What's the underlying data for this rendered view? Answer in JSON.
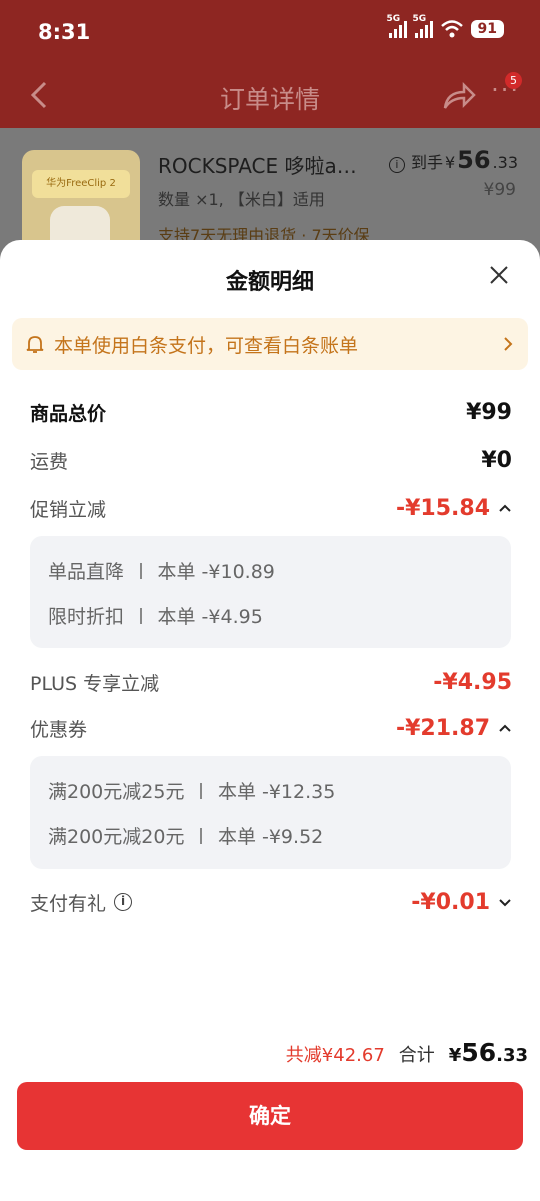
{
  "status": {
    "time": "8:31",
    "net1": "5G",
    "net2": "5G",
    "battery": "91"
  },
  "nav": {
    "title": "订单详情",
    "badge": "5",
    "more": "···"
  },
  "product": {
    "title": "ROCKSPACE 哆啦a…",
    "image_banner": "华为FreeClip 2",
    "spec": "数量 ×1, 【米白】适用",
    "service": "支持7天无理由退货 · 7天价保",
    "price_prefix": "到手",
    "price_currency": "¥",
    "price_int": "56",
    "price_dec": ".33",
    "original_price": "¥99"
  },
  "sheet": {
    "title": "金额明细",
    "notice": "本单使用白条支付，可查看白条账单",
    "rows": {
      "goods_total": {
        "label": "商品总价",
        "value": "¥99"
      },
      "shipping": {
        "label": "运费",
        "value": "¥0"
      },
      "promo": {
        "label": "促销立减",
        "value": "-¥15.84"
      },
      "plus": {
        "label": "PLUS 专享立减",
        "value": "-¥4.95"
      },
      "coupon": {
        "label": "优惠券",
        "value": "-¥21.87"
      },
      "pay_gift": {
        "label": "支付有礼",
        "value": "-¥0.01"
      }
    },
    "promo_details": [
      {
        "name": "单品直降",
        "amount": "本单 -¥10.89"
      },
      {
        "name": "限时折扣",
        "amount": "本单 -¥4.95"
      }
    ],
    "coupon_details": [
      {
        "name": "满200元减25元",
        "amount": "本单 -¥12.35"
      },
      {
        "name": "满200元减20元",
        "amount": "本单 -¥9.52"
      }
    ],
    "summary": {
      "saved": "共减¥42.67",
      "total_label": "合计",
      "total_currency": "¥",
      "total_int": "56",
      "total_dec": ".33"
    },
    "confirm_label": "确定"
  },
  "colors": {
    "accent_red": "#e73434",
    "discount_red": "#e33b2d",
    "notice_orange": "#c4741b",
    "notice_bg": "#fdf4e3"
  }
}
